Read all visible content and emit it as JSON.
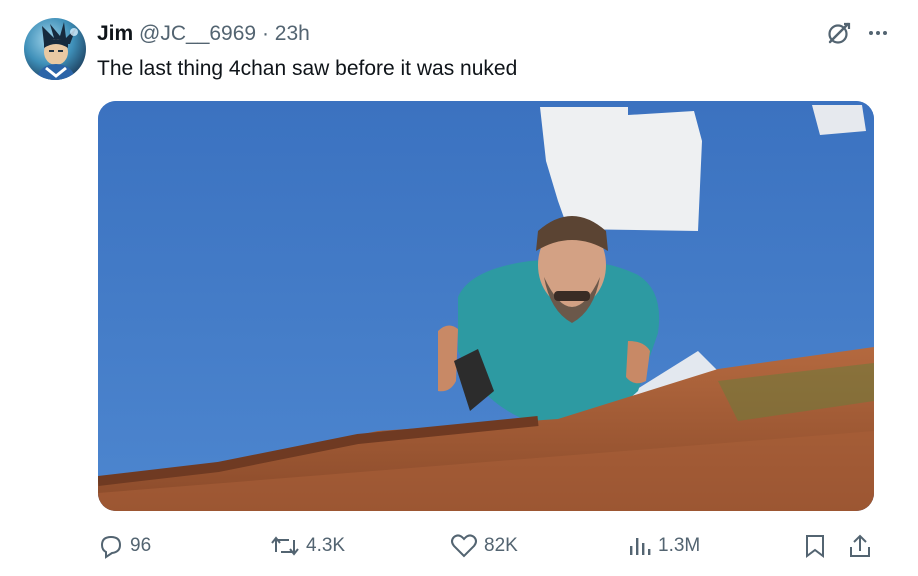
{
  "tweet": {
    "author": {
      "name": "Jim",
      "handle": "@JC__6969",
      "separator": "·",
      "time": "23h"
    },
    "text": "The last thing 4chan saw before it was nuked",
    "media": {
      "icon": "video-still-image"
    }
  },
  "toolbar": {
    "grok_icon": "grok-icon",
    "more_icon": "more-icon"
  },
  "actions": {
    "replies": "96",
    "reposts": "4.3K",
    "likes": "82K",
    "views": "1.3M"
  },
  "colors": {
    "text": "#0f1419",
    "secondary": "#536471",
    "sky": "#3d78c6"
  }
}
